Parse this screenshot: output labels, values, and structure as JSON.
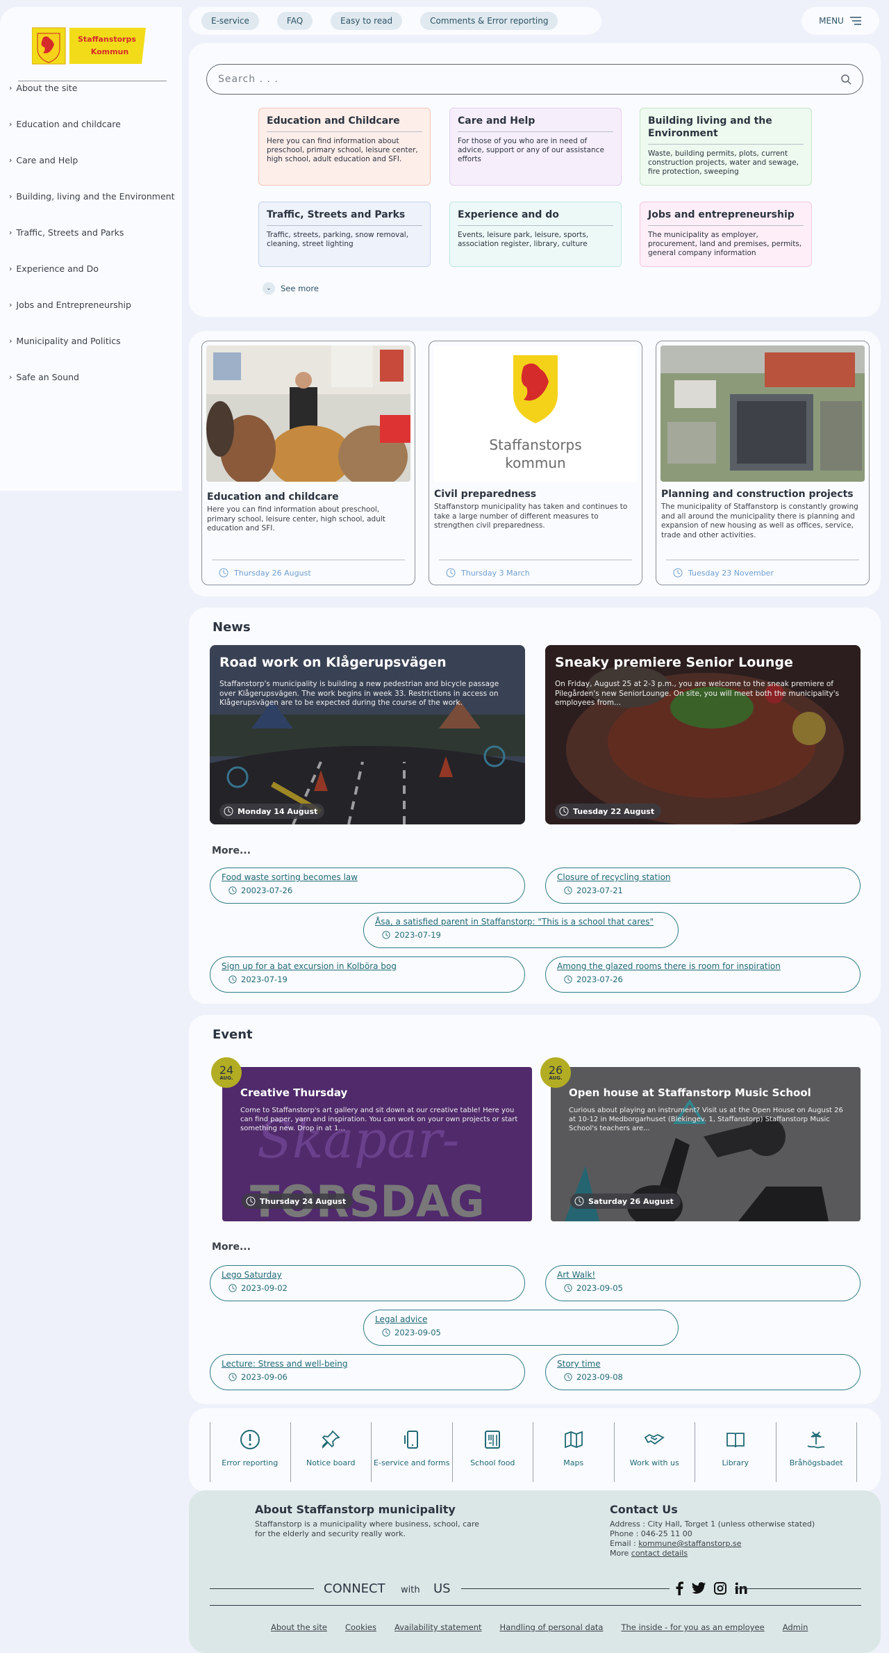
{
  "logo": {
    "line1": "Staffanstorps",
    "line2": "Kommun"
  },
  "sidebar": {
    "items": [
      {
        "label": "About the site"
      },
      {
        "label": "Education and childcare"
      },
      {
        "label": "Care and Help"
      },
      {
        "label": "Building, living and the Environment"
      },
      {
        "label": "Traffic, Streets and Parks"
      },
      {
        "label": "Experience and Do"
      },
      {
        "label": "Jobs and Entrepreneurship"
      },
      {
        "label": "Municipality and Politics"
      },
      {
        "label": "Safe an Sound"
      }
    ]
  },
  "topbar": {
    "items": [
      "E-service",
      "FAQ",
      "Easy to read",
      "Comments & Error reporting"
    ],
    "menu": "MENU"
  },
  "search": {
    "placeholder": "Search . . ."
  },
  "categories": [
    {
      "title": "Education and Childcare",
      "text": "Here you can find information about preschool, primary school, leisure center, high school, adult education and SFI.",
      "bg": "#fdeeea",
      "border": "#f4c5b6"
    },
    {
      "title": "Care and Help",
      "text": "For those of you who are in need of advice, support or any of our assistance efforts",
      "bg": "#f6effb",
      "border": "#e3cdef"
    },
    {
      "title": "Building living and the Environment",
      "text": "Waste, building permits, plots, current construction projects, water and sewage, fire protection, sweeping",
      "bg": "#eef9ef",
      "border": "#c3e6c8"
    },
    {
      "title": "Traffic, Streets and Parks",
      "text": "Traffic, streets, parking, snow removal, cleaning, street lighting",
      "bg": "#eef2fb",
      "border": "#c5d3ef"
    },
    {
      "title": "Experience and do",
      "text": "Events, leisure park, leisure, sports, association register, library, culture",
      "bg": "#edf9f7",
      "border": "#bfe7e0"
    },
    {
      "title": "Jobs and entrepreneurship",
      "text": "The municipality as employer, procurement, land and premises, permits, general company information",
      "bg": "#fdeef7",
      "border": "#f4c6e1"
    }
  ],
  "see_more": "See more",
  "featured": [
    {
      "title": "Education and childcare",
      "text": "Here you can find information about preschool, primary school, leisure center, high school, adult education and SFI.",
      "date": "Thursday 26 August"
    },
    {
      "title": "Civil preparedness",
      "text": "Staffanstorp municipality has taken and continues to take a large number of different measures to strengthen civil preparedness.",
      "date": "Thursday 3 March",
      "logo_line1": "Staffanstorps",
      "logo_line2": "kommun"
    },
    {
      "title": "Planning and construction projects",
      "text": "The municipality of Staffanstorp is constantly growing and all around the municipality there is planning and expansion of new housing as well as offices, service, trade and other activities.",
      "date": "Tuesday 23 November"
    }
  ],
  "news": {
    "heading": "News",
    "items": [
      {
        "title": "Road work on Klågerupsvägen",
        "text": "Staffanstorp's municipality is building a new pedestrian and bicycle passage over Klågerupsvägen. The work begins in week 33. Restrictions in access on Klågerupsvägen are to be expected during the course of the work.",
        "date": "Monday 14 August"
      },
      {
        "title": "Sneaky premiere Senior Lounge",
        "text": "On Friday, August 25 at 2-3 p.m., you are welcome to the sneak premiere of Pilegården's new SeniorLounge. On site, you will meet both the municipality's employees from...",
        "date": "Tuesday 22 August"
      }
    ],
    "more_label": "More...",
    "more": [
      {
        "title": "Food waste sorting becomes law",
        "date": "20023-07-26"
      },
      {
        "title": "Closure of recycling station",
        "date": "2023-07-21"
      },
      {
        "title": "Åsa, a satisfied parent in Staffanstorp: \"This is a school that cares\"",
        "date": "2023-07-19"
      },
      {
        "title": "Sign up for a bat excursion in Kolböra bog",
        "date": "2023-07-19"
      },
      {
        "title": "Among the glazed rooms there is room for inspiration",
        "date": "2023-07-26"
      }
    ]
  },
  "events": {
    "heading": "Event",
    "items": [
      {
        "day": "24",
        "month": "AUG.",
        "title": "Creative Thursday",
        "text": "Come to Staffanstorp's art gallery and sit down at our creative table! Here you can find paper, yarn and inspiration. You can work on your own projects or start something new. Drop in at 1...",
        "date": "Thursday 24 August",
        "art_top": "Skapar-",
        "art_bottom": "TORSDAG"
      },
      {
        "day": "26",
        "month": "AUG.",
        "title": "Open house at Staffanstorp Music School",
        "text": "Curious about playing an instrument? Visit us at the Open House on August 26 at 10-12 in Medborgarhuset (Blekingev. 1, Staffanstorp) Staffanstorp Music School's teachers are...",
        "date": "Saturday 26 August"
      }
    ],
    "more_label": "More...",
    "more": [
      {
        "title": "Lego Saturday",
        "date": "2023-09-02"
      },
      {
        "title": "Art Walk!",
        "date": "2023-09-05"
      },
      {
        "title": "Legal advice",
        "date": "2023-09-05"
      },
      {
        "title": "Lecture: Stress and well-being",
        "date": "2023-09-06"
      },
      {
        "title": "Story time",
        "date": "2023-09-08"
      }
    ]
  },
  "quicklinks": [
    {
      "label": "Error reporting",
      "icon": "exclamation-icon"
    },
    {
      "label": "Notice board",
      "icon": "pin-icon"
    },
    {
      "label": "E-service and forms",
      "icon": "phone-icon"
    },
    {
      "label": "School food",
      "icon": "menu-icon"
    },
    {
      "label": "Maps",
      "icon": "map-icon"
    },
    {
      "label": "Work with us",
      "icon": "handshake-icon"
    },
    {
      "label": "Library",
      "icon": "book-icon"
    },
    {
      "label": "Bråhögsbadet",
      "icon": "island-icon"
    }
  ],
  "footer": {
    "about_title": "About Staffanstorp municipality",
    "about_text": "Staffanstorp is a municipality where business, school, care for the elderly and security really work.",
    "contact_title": "Contact Us",
    "address": "Address : City Hall, Torget 1 (unless otherwise stated)",
    "phone": "Phone : 046-25 11 00",
    "email_label": "Email :",
    "email": "kommune@staffanstorp.se",
    "more_label": "More",
    "more_link": "contact details",
    "connect": "CONNECT",
    "with": "with",
    "us": "US",
    "links": [
      "About the site",
      "Cookies",
      "Availability statement",
      "Handling of personal data",
      "The inside - for you as an employee",
      "Admin"
    ]
  }
}
